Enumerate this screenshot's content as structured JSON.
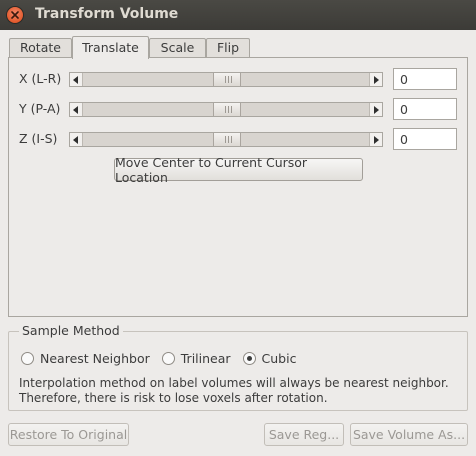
{
  "window": {
    "title": "Transform Volume"
  },
  "tabs": [
    {
      "label": "Rotate",
      "active": false
    },
    {
      "label": "Translate",
      "active": true
    },
    {
      "label": "Scale",
      "active": false
    },
    {
      "label": "Flip",
      "active": false
    }
  ],
  "translate": {
    "sliders": [
      {
        "label": "X (L-R)",
        "value": "0",
        "position": 0.5
      },
      {
        "label": "Y (P-A)",
        "value": "0",
        "position": 0.5
      },
      {
        "label": "Z (I-S)",
        "value": "0",
        "position": 0.5
      }
    ],
    "move_center_label": "Move Center to Current Cursor Location"
  },
  "sample_method": {
    "title": "Sample Method",
    "options": [
      {
        "label": "Nearest Neighbor",
        "checked": false
      },
      {
        "label": "Trilinear",
        "checked": false
      },
      {
        "label": "Cubic",
        "checked": true
      }
    ],
    "note_line1": "Interpolation method on label volumes will always be nearest neighbor.",
    "note_line2": "Therefore, there is risk to lose voxels after rotation."
  },
  "buttons": {
    "restore": "Restore To Original",
    "save_reg": "Save Reg...",
    "save_volume": "Save Volume As..."
  },
  "colors": {
    "titlebar": "#3c3b37",
    "window_bg": "#edebe9",
    "close_button": "#e25a2d"
  }
}
